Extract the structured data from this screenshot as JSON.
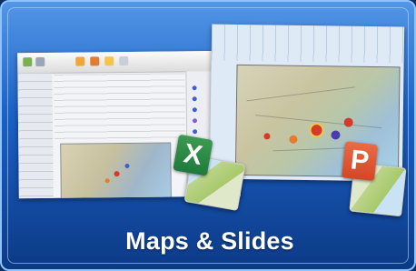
{
  "tile": {
    "caption": "Maps & Slides"
  },
  "icons": {
    "excel": {
      "letter": "X",
      "color": "#1e7a3a"
    },
    "powerpoint": {
      "letter": "P",
      "color": "#d24726"
    }
  },
  "colors": {
    "background": "#1b5ec2",
    "border": "#8fc3ff"
  }
}
